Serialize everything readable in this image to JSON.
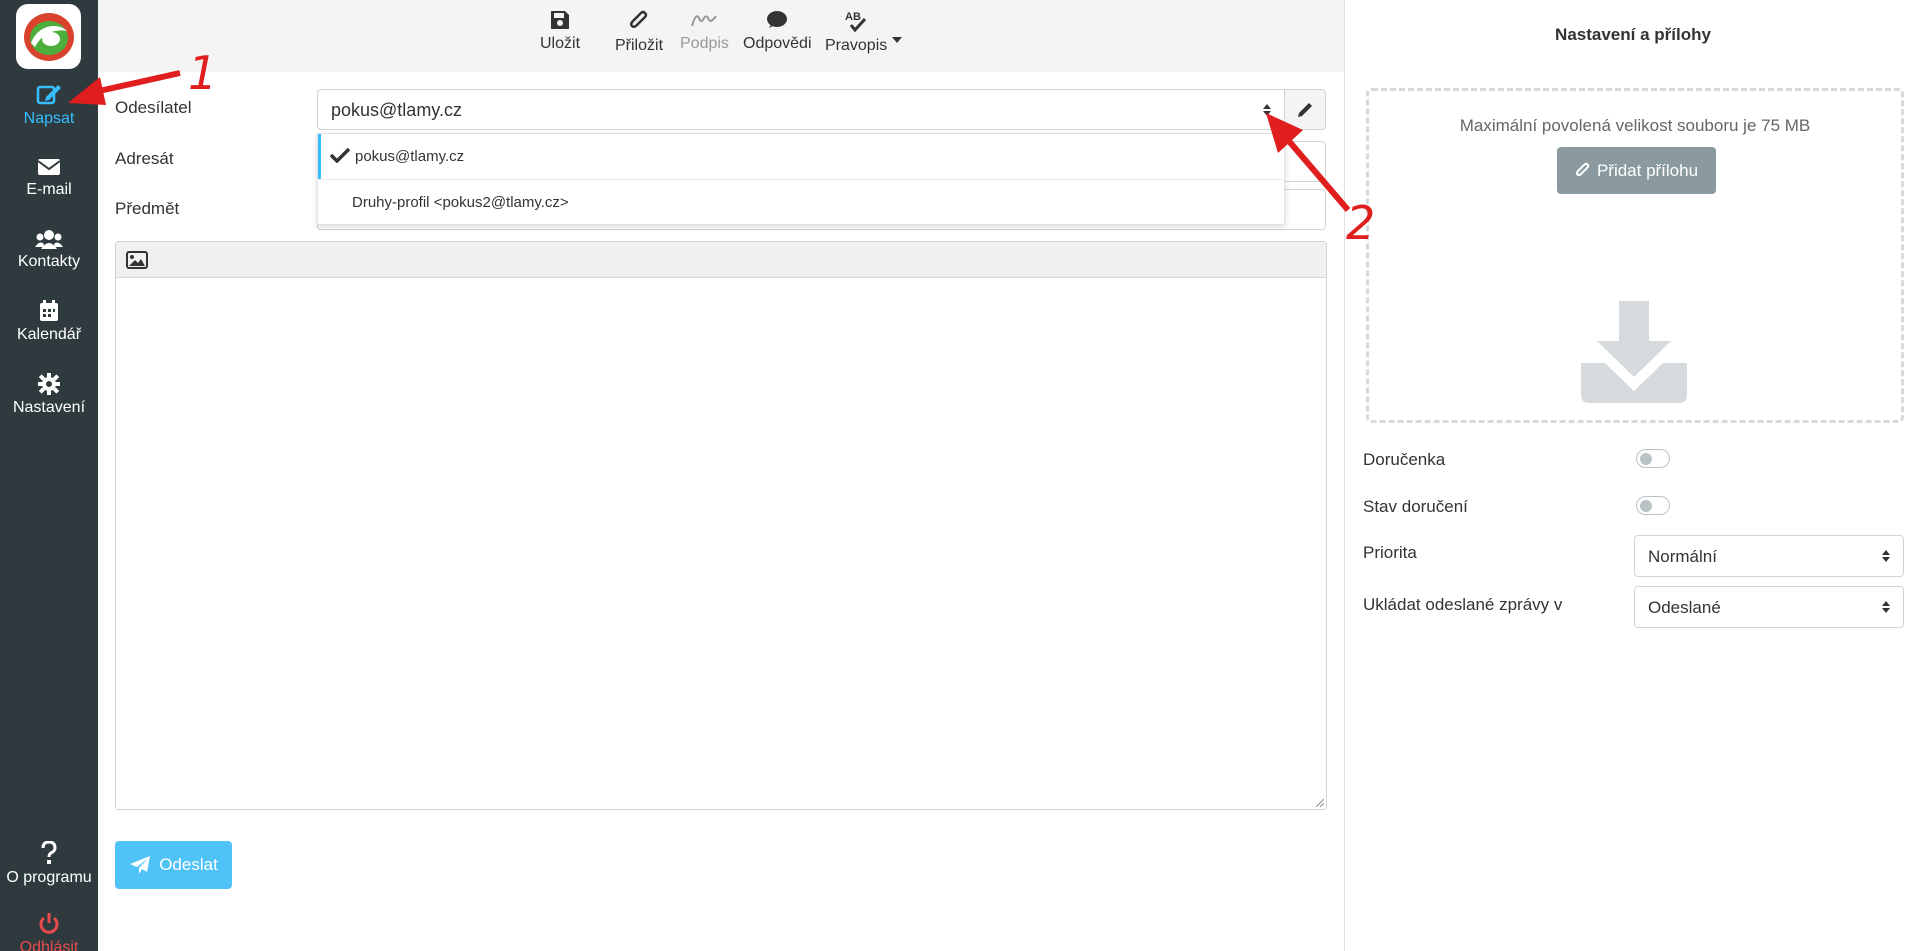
{
  "sidebar": {
    "items": [
      {
        "label": "Napsat",
        "icon": "compose-icon",
        "active": true
      },
      {
        "label": "E-mail",
        "icon": "envelope-icon"
      },
      {
        "label": "Kontakty",
        "icon": "users-icon"
      },
      {
        "label": "Kalendář",
        "icon": "calendar-icon"
      },
      {
        "label": "Nastavení",
        "icon": "gear-icon"
      }
    ],
    "about_label": "O programu",
    "logout_label": "Odhlásit"
  },
  "toolbar": {
    "save": "Uložit",
    "attach": "Přiložit",
    "signature": "Podpis",
    "responses": "Odpovědi",
    "spellcheck": "Pravopis"
  },
  "compose": {
    "sender_label": "Odesílatel",
    "recipient_label": "Adresát",
    "subject_label": "Předmět",
    "sender_value": "pokus@tlamy.cz",
    "sender_options": [
      "pokus@tlamy.cz",
      "Druhy-profil <pokus2@tlamy.cz>"
    ],
    "send_label": "Odeslat"
  },
  "right_panel": {
    "title": "Nastavení a přílohy",
    "max_size_text": "Maximální povolená velikost souboru je 75 MB",
    "add_attachment": "Přidat přílohu",
    "receipt_label": "Doručenka",
    "dsn_label": "Stav doručení",
    "priority_label": "Priorita",
    "priority_value": "Normální",
    "store_label": "Ukládat odeslané zprávy v",
    "store_value": "Odeslané",
    "receipt_on": false,
    "dsn_on": false
  },
  "annotations": {
    "first": "1",
    "second": "2"
  },
  "colors": {
    "accent": "#37beff",
    "sidebar": "#2f3a3f",
    "danger": "#e84b4b",
    "annotation": "#e01e1e"
  }
}
